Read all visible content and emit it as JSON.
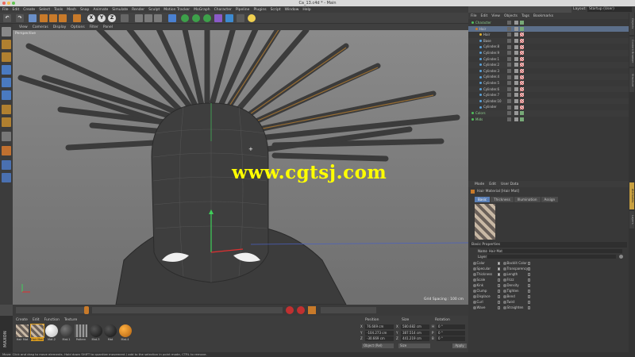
{
  "window": {
    "title": "Ca_13.c4d * - Main"
  },
  "menubar": [
    "File",
    "Edit",
    "Create",
    "Select",
    "Tools",
    "Mesh",
    "Snap",
    "Animate",
    "Simulate",
    "Render",
    "Sculpt",
    "Motion Tracker",
    "MoGraph",
    "Character",
    "Pipeline",
    "Plugins",
    "Script",
    "Window",
    "Help"
  ],
  "layout": {
    "label": "Layout:",
    "value": "Startup (User)"
  },
  "toolbar": {
    "x": "X",
    "y": "Y",
    "z": "Z"
  },
  "viewport": {
    "menu": [
      "View",
      "Cameras",
      "Display",
      "Options",
      "Filter",
      "Panel"
    ],
    "camera_label": "Perspective",
    "grid_spacing": "Grid Spacing : 100 cm"
  },
  "watermark": "www.cgtsj.com",
  "material_manager": {
    "menu": [
      "Create",
      "Edit",
      "Function",
      "Texture"
    ],
    "materials": [
      {
        "label": "Hair Mat",
        "swatch": "hair"
      },
      {
        "label": "Hair Mat",
        "swatch": "hair-selected"
      },
      {
        "label": "Mat.2",
        "swatch": "white"
      },
      {
        "label": "Mat.1",
        "swatch": "dark"
      },
      {
        "label": "Pattern",
        "swatch": "pattern"
      },
      {
        "label": "Mat.3",
        "swatch": "black"
      },
      {
        "label": "Mat",
        "swatch": "black"
      },
      {
        "label": "Mat.4",
        "swatch": "orange"
      }
    ],
    "brand": "MAXON"
  },
  "coordinates": {
    "headers": [
      "Position",
      "Size",
      "Rotation"
    ],
    "rows": [
      {
        "axis": "X",
        "position": "76.669 cm",
        "size_axis": "X",
        "size": "580.682 cm",
        "rot_axis": "H",
        "rotation": "0 °"
      },
      {
        "axis": "Y",
        "position": "-104.273 cm",
        "size_axis": "Y",
        "size": "387.514 cm",
        "rot_axis": "P",
        "rotation": "0 °"
      },
      {
        "axis": "Z",
        "position": "-30.669 cm",
        "size_axis": "Z",
        "size": "441.219 cm",
        "rot_axis": "B",
        "rotation": "0 °"
      }
    ],
    "mode_dropdown": "Object (Rel)",
    "size_dropdown": "Size",
    "apply_label": "Apply"
  },
  "object_manager": {
    "menu": [
      "File",
      "Edit",
      "View",
      "Objects",
      "Tags",
      "Bookmarks"
    ],
    "objects": [
      {
        "name": "Character",
        "indent": 0,
        "color": "#4fc05a",
        "selected": false
      },
      {
        "name": "Hair",
        "indent": 1,
        "color": "#c87a2a",
        "selected": true
      },
      {
        "name": "Hair",
        "indent": 2,
        "color": "#e0b030",
        "selected": false
      },
      {
        "name": "Base",
        "indent": 2,
        "color": "#5aa0d8",
        "selected": false
      },
      {
        "name": "Cylinder.8",
        "indent": 2,
        "color": "#5aa0d8",
        "selected": false
      },
      {
        "name": "Cylinder.9",
        "indent": 2,
        "color": "#5aa0d8",
        "selected": false
      },
      {
        "name": "Cylinder.1",
        "indent": 2,
        "color": "#5aa0d8",
        "selected": false
      },
      {
        "name": "Cylinder.2",
        "indent": 2,
        "color": "#5aa0d8",
        "selected": false
      },
      {
        "name": "Cylinder.3",
        "indent": 2,
        "color": "#5aa0d8",
        "selected": false
      },
      {
        "name": "Cylinder.4",
        "indent": 2,
        "color": "#5aa0d8",
        "selected": false
      },
      {
        "name": "Cylinder.5",
        "indent": 2,
        "color": "#5aa0d8",
        "selected": false
      },
      {
        "name": "Cylinder.6",
        "indent": 2,
        "color": "#5aa0d8",
        "selected": false
      },
      {
        "name": "Cylinder.7",
        "indent": 2,
        "color": "#5aa0d8",
        "selected": false
      },
      {
        "name": "Cylinder.10",
        "indent": 2,
        "color": "#5aa0d8",
        "selected": false
      },
      {
        "name": "Cylinder",
        "indent": 2,
        "color": "#5aa0d8",
        "selected": false
      },
      {
        "name": "Colors",
        "indent": 0,
        "color": "#4fc05a",
        "selected": false
      },
      {
        "name": "Mids",
        "indent": 0,
        "color": "#4fc05a",
        "selected": false
      }
    ]
  },
  "attributes": {
    "menu": [
      "Mode",
      "Edit",
      "User Data"
    ],
    "title": "Hair Material [Hair Mat]",
    "tabs": [
      "Basic",
      "Thickness",
      "Illumination",
      "Assign"
    ],
    "active_tab": "Basic",
    "section": "Basic Properties",
    "name_label": "Name",
    "name_value": "Hair Mat",
    "layer_label": "Layer",
    "channels_left": [
      {
        "label": "Color",
        "on": true
      },
      {
        "label": "Specular",
        "on": true
      },
      {
        "label": "Thickness",
        "on": true
      },
      {
        "label": "Scale",
        "on": false
      },
      {
        "label": "Kink",
        "on": false
      },
      {
        "label": "Clump",
        "on": false
      },
      {
        "label": "Displace",
        "on": false
      },
      {
        "label": "Curl",
        "on": false
      },
      {
        "label": "Wave",
        "on": false
      }
    ],
    "channels_right": [
      {
        "label": "Backlit Color",
        "on": false
      },
      {
        "label": "Transparency",
        "on": false
      },
      {
        "label": "Length",
        "on": false
      },
      {
        "label": "Frizz",
        "on": false
      },
      {
        "label": "Density",
        "on": false
      },
      {
        "label": "Tighten",
        "on": false
      },
      {
        "label": "Bend",
        "on": false
      },
      {
        "label": "Twist",
        "on": false
      },
      {
        "label": "Straighten",
        "on": false
      }
    ]
  },
  "right_tabs": [
    "Objects",
    "Content Browser",
    "Structure",
    "Attributes",
    "Layers"
  ],
  "status": "Move: Click and drag to move elements. Hold down SHIFT to quantize movement / add to the selection in point mode, CTRL to remove."
}
